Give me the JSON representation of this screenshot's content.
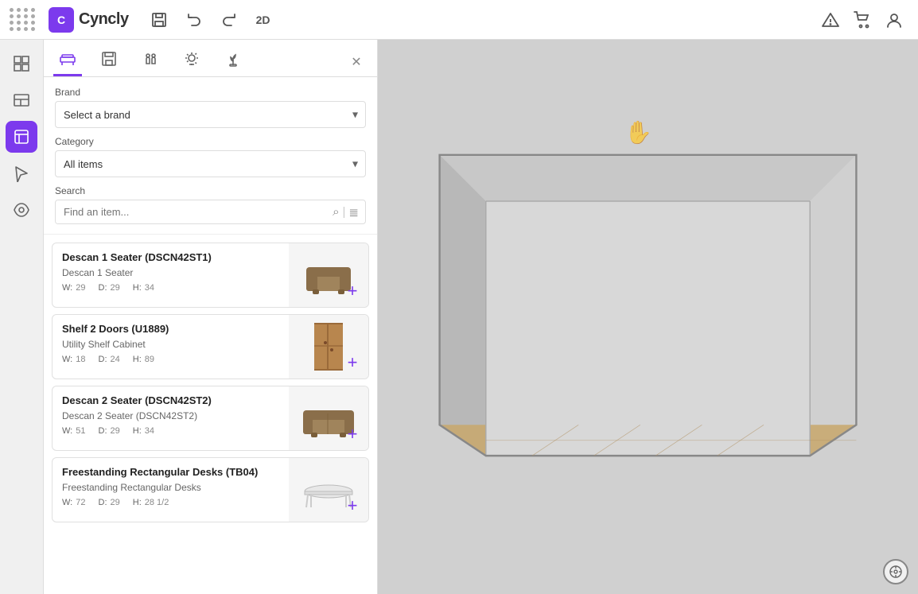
{
  "app": {
    "name": "Cyncly",
    "logo_letter": "C"
  },
  "topbar": {
    "save_label": "💾",
    "undo_label": "↩",
    "redo_label": "↪",
    "view2d_label": "2D",
    "alert_icon": "△",
    "cart_icon": "🛒",
    "user_icon": "👤"
  },
  "panel": {
    "close_label": "✕",
    "tabs": [
      {
        "id": "furniture",
        "icon": "⬛",
        "active": true
      },
      {
        "id": "save",
        "icon": "🔖"
      },
      {
        "id": "move",
        "icon": "✦"
      },
      {
        "id": "light",
        "icon": "💡"
      },
      {
        "id": "plant",
        "icon": "🌿"
      }
    ],
    "brand": {
      "label": "Brand",
      "placeholder": "Select a brand",
      "value": ""
    },
    "category": {
      "label": "Category",
      "placeholder": "All items",
      "value": "All items"
    },
    "search": {
      "label": "Search",
      "placeholder": "Find an item..."
    }
  },
  "items": [
    {
      "name": "Descan 1 Seater (DSCN42ST1)",
      "subtitle": "Descan 1 Seater",
      "dims": {
        "w": "29",
        "d": "29",
        "h": "34"
      },
      "type": "sofa1"
    },
    {
      "name": "Shelf 2 Doors (U1889)",
      "subtitle": "Utility Shelf Cabinet",
      "dims": {
        "w": "18",
        "d": "24",
        "h": "89"
      },
      "type": "shelf"
    },
    {
      "name": "Descan 2 Seater (DSCN42ST2)",
      "subtitle": "Descan 2 Seater (DSCN42ST2)",
      "dims": {
        "w": "51",
        "d": "29",
        "h": "34"
      },
      "type": "sofa2"
    },
    {
      "name": "Freestanding Rectangular Desks (TB04)",
      "subtitle": "Freestanding Rectangular Desks",
      "dims": {
        "w": "72",
        "d": "29",
        "h": "28 1/2"
      },
      "type": "table"
    }
  ],
  "dims_labels": {
    "w": "W:",
    "d": "D:",
    "h": "H:"
  },
  "viewport": {
    "compass_icon": "⊕"
  }
}
